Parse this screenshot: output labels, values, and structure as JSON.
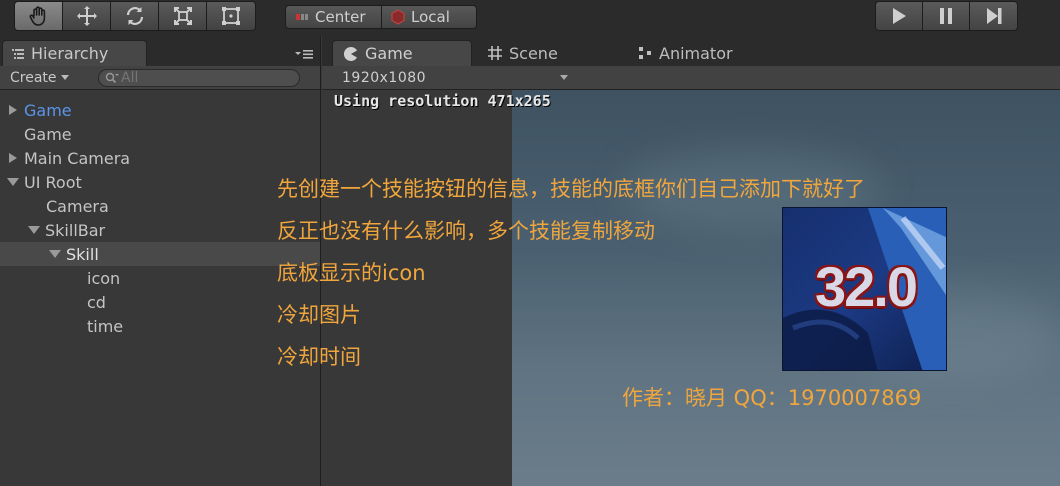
{
  "toolbar": {
    "tools": [
      {
        "icon": "hand-icon",
        "active": true
      },
      {
        "icon": "move-icon",
        "active": false
      },
      {
        "icon": "rotate-icon",
        "active": false
      },
      {
        "icon": "scale-icon",
        "active": false
      },
      {
        "icon": "rect-tool-icon",
        "active": false
      }
    ],
    "pivot_label": "Center",
    "space_label": "Local",
    "play_controls": [
      "play-icon",
      "pause-icon",
      "step-icon"
    ]
  },
  "hierarchy": {
    "tab_label": "Hierarchy",
    "create_label": "Create",
    "search_placeholder": "All",
    "items": [
      {
        "label": "Game",
        "expandable": true,
        "expanded": false,
        "highlighted": true
      },
      {
        "label": "Game",
        "expandable": false
      },
      {
        "label": "Main Camera",
        "expandable": true,
        "expanded": false
      },
      {
        "label": "UI Root",
        "expandable": true,
        "expanded": true
      },
      {
        "label": "Camera",
        "expandable": false
      },
      {
        "label": "SkillBar",
        "expandable": true,
        "expanded": true
      },
      {
        "label": "Skill",
        "expandable": true,
        "expanded": true,
        "selected": true
      },
      {
        "label": "icon",
        "expandable": false
      },
      {
        "label": "cd",
        "expandable": false
      },
      {
        "label": "time",
        "expandable": false
      }
    ]
  },
  "gameview": {
    "tabs": [
      {
        "label": "Game",
        "icon": "game-pacman-icon",
        "active": true
      },
      {
        "label": "Scene",
        "icon": "scene-grid-icon",
        "active": false
      },
      {
        "label": "Animator",
        "icon": "animator-icon",
        "active": false
      }
    ],
    "resolution_option": "1920x1080",
    "resolution_note": "Using resolution 471x265",
    "skill_time_text": "32.0"
  },
  "annotations": {
    "line1": "先创建一个技能按钮的信息，技能的底框你们自己添加下就好了",
    "line2": "反正也没有什么影响，多个技能复制移动",
    "line3": "底板显示的icon",
    "line4": "冷却图片",
    "line5": "冷却时间",
    "author": "作者：晓月 QQ：1970007869"
  },
  "colors": {
    "annotation": "#f0a63c",
    "highlight_text": "#5a95ea",
    "panel_bg": "#383838",
    "toolbar_bg": "#2b2b2b"
  }
}
